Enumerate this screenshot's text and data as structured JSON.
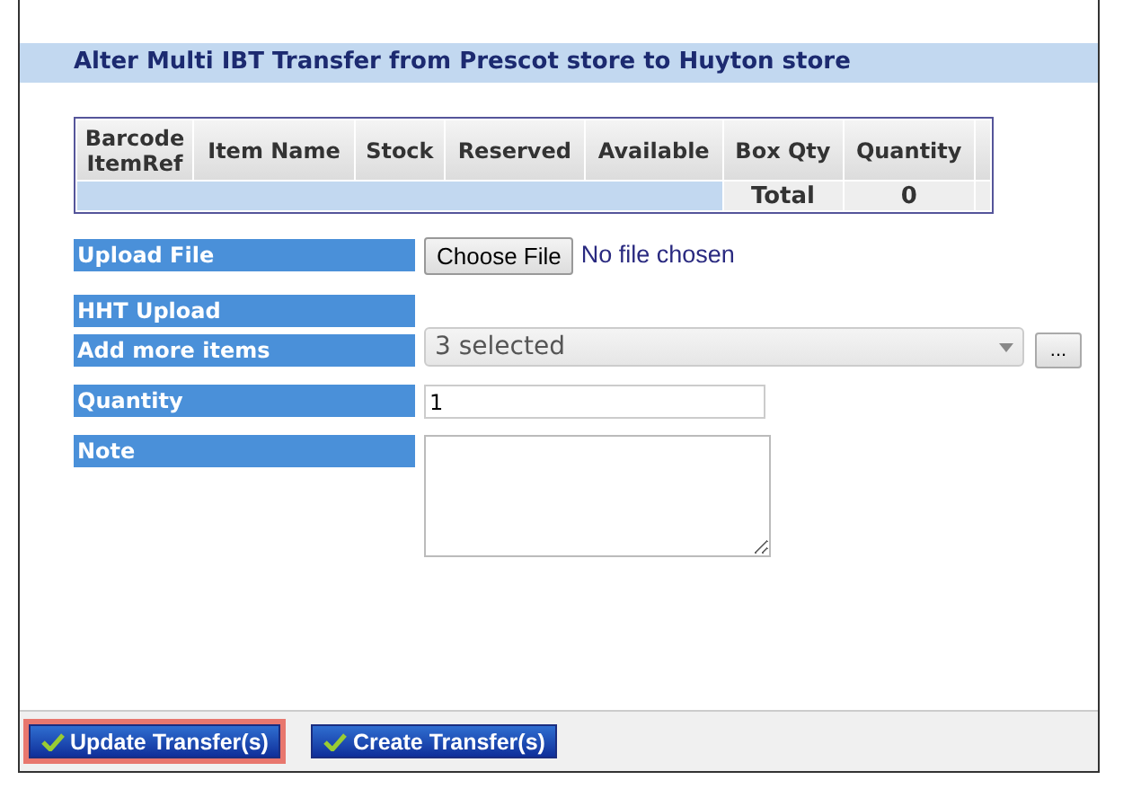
{
  "panel": {
    "title": "Alter Multi IBT Transfer from Prescot store to Huyton store"
  },
  "table": {
    "columns": [
      "Barcode ItemRef",
      "Item Name",
      "Stock",
      "Reserved",
      "Available",
      "Box Qty",
      "Quantity"
    ],
    "footer": {
      "label": "Total",
      "value": "0"
    }
  },
  "form": [
    {
      "kind": "file",
      "label": "Upload File",
      "button": "Choose File",
      "status": "No file chosen"
    },
    {
      "kind": "none",
      "label": "HHT Upload"
    },
    {
      "kind": "multiselect",
      "label": "Add more items",
      "value": "3 selected",
      "button": "..."
    },
    {
      "kind": "text",
      "label": "Quantity",
      "value": "1"
    },
    {
      "kind": "textarea",
      "label": "Note"
    }
  ],
  "buttons": [
    {
      "label": "Update Transfer(s)",
      "highlighted": true
    },
    {
      "label": "Create Transfer(s)",
      "highlighted": false
    }
  ]
}
